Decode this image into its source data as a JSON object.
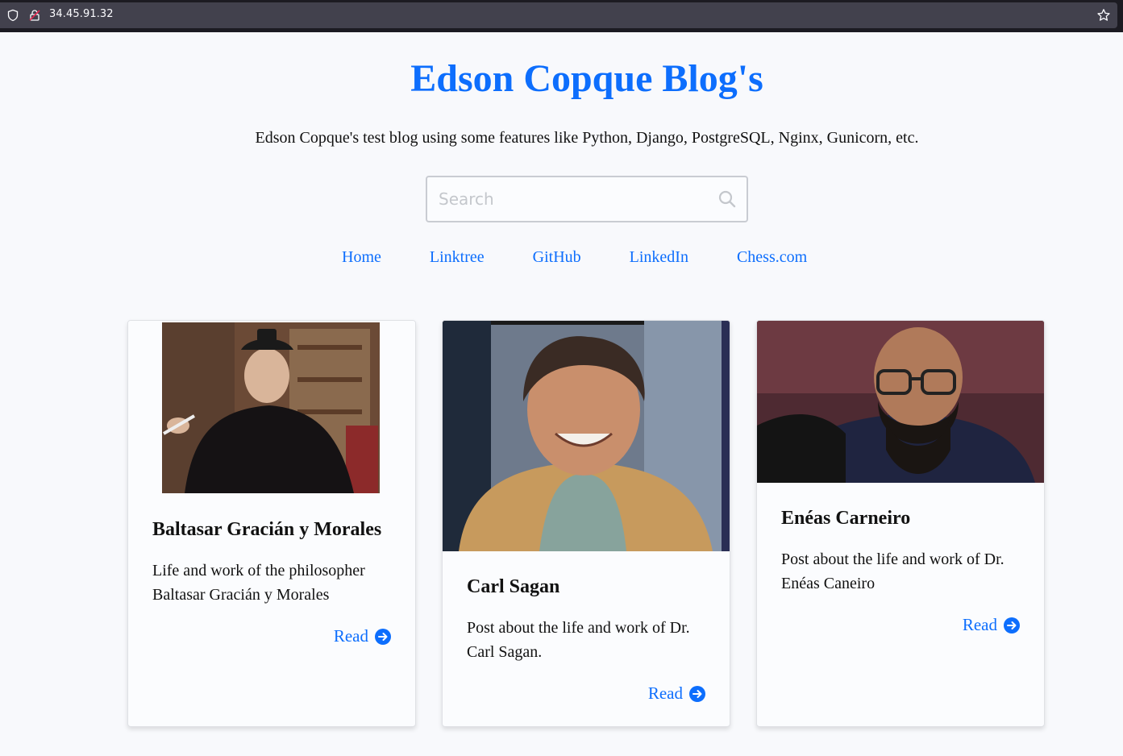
{
  "browser": {
    "url": "34.45.91.32"
  },
  "header": {
    "title": "Edson Copque Blog's",
    "subtitle": "Edson Copque's test blog using some features like Python, Django, PostgreSQL, Nginx, Gunicorn, etc."
  },
  "search": {
    "placeholder": "Search",
    "value": ""
  },
  "nav": {
    "items": [
      {
        "label": "Home"
      },
      {
        "label": "Linktree"
      },
      {
        "label": "GitHub"
      },
      {
        "label": "LinkedIn"
      },
      {
        "label": "Chess.com"
      }
    ]
  },
  "posts": [
    {
      "title": "Baltasar Gracián y Morales",
      "excerpt": "Life and work of the philosopher Baltasar Gracián y Morales",
      "read_label": "Read"
    },
    {
      "title": "Carl Sagan",
      "excerpt": "Post about the life and work of Dr. Carl Sagan.",
      "read_label": "Read"
    },
    {
      "title": "Enéas Carneiro",
      "excerpt": "Post about the life and work of Dr. Enéas Caneiro",
      "read_label": "Read"
    }
  ],
  "colors": {
    "accent": "#0d6efd",
    "background": "#f8f9fc"
  }
}
